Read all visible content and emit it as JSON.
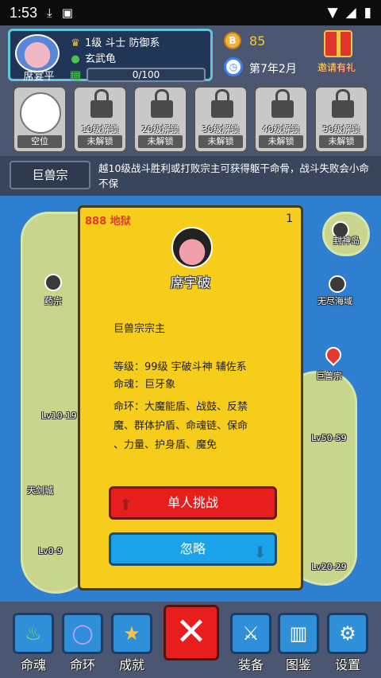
{
  "status_bar": {
    "time": "1:53"
  },
  "player": {
    "name": "席宴平",
    "level_line": "1级 斗士 防御系",
    "soul": "玄武龟",
    "exp": "0/100"
  },
  "resources": {
    "coins": "85",
    "date": "第7年2月",
    "gift_label": "邀请有礼"
  },
  "slots": [
    {
      "req": "",
      "label": "空位"
    },
    {
      "req": "10级解锁",
      "label": "未解锁"
    },
    {
      "req": "20级解锁",
      "label": "未解锁"
    },
    {
      "req": "30级解锁",
      "label": "未解锁"
    },
    {
      "req": "40级解锁",
      "label": "未解锁"
    },
    {
      "req": "50级解锁",
      "label": "未解锁"
    }
  ],
  "sect": {
    "name": "巨兽宗",
    "desc": "越10级战斗胜利或打败宗主可获得躯干命骨，战斗失败会小命不保"
  },
  "map_labels": {
    "fengshen": "封神岛",
    "wujin": "无尽海域",
    "xiao": "药宗",
    "juhuo": "巨兽宗",
    "tianshou": "天剑城",
    "right_lv": "Lv50-59",
    "lv1019": "Lv10-19",
    "lv09": "Lv0-9",
    "lv2029": "Lv20-29"
  },
  "dialog": {
    "tag": "888 地狱",
    "count": "1",
    "boss_name": "席宇破",
    "title": "巨兽宗宗主",
    "level": "等级：99级 宇破斗神 辅佐系",
    "soul": "命魂：巨牙象",
    "rings_1": "命环：大魔能盾、战鼓、反禁",
    "rings_2": "魔、群体护盾、命魂链、保命",
    "rings_3": "、力量、护身盾、魔免",
    "challenge": "单人挑战",
    "ignore": "忽略"
  },
  "nav": {
    "soul": "命魂",
    "ring": "命环",
    "achieve": "成就",
    "equip": "装备",
    "atlas": "图鉴",
    "settings": "设置"
  },
  "colors": {
    "dialog_bg": "#f6cd1a",
    "challenge": "#e81d1d",
    "ignore": "#1ba3ea",
    "sea": "#2e7fd0"
  }
}
